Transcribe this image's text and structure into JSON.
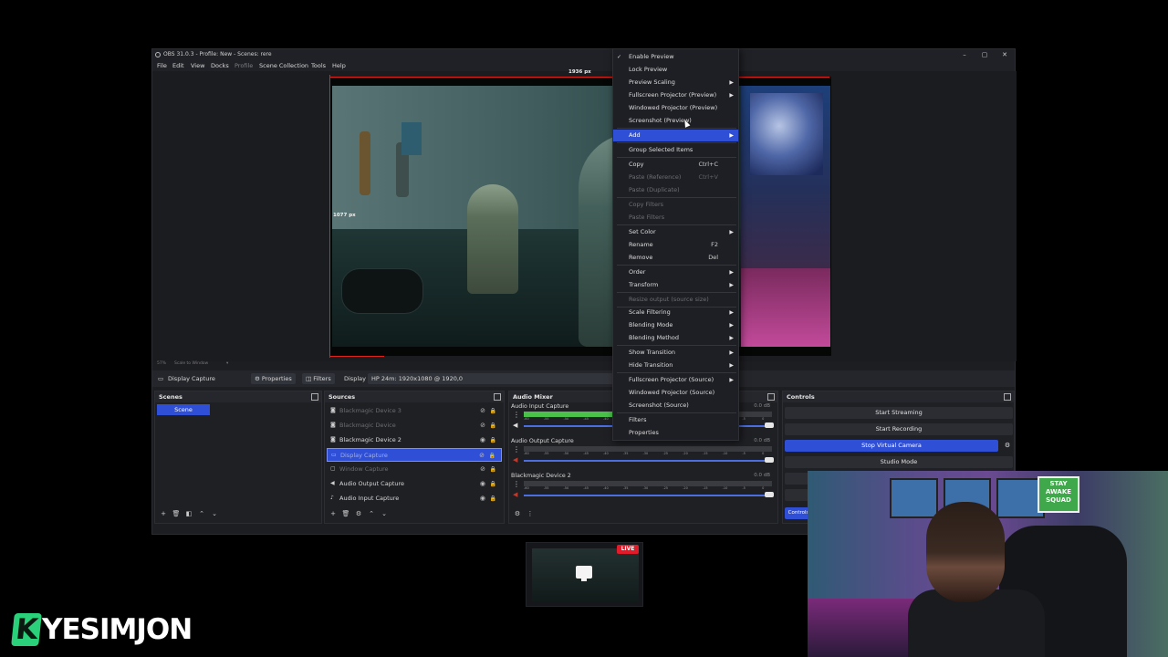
{
  "window": {
    "title": "OBS 31.0.3 - Profile: New - Scenes: rere",
    "minimize": "–",
    "maximize": "▢",
    "close": "✕"
  },
  "menubar": [
    "File",
    "Edit",
    "View",
    "Docks",
    "Profile",
    "Scene Collection",
    "Tools",
    "Help"
  ],
  "preview": {
    "width_label": "1936 px",
    "height_label": "1077 px",
    "zoom": "57%",
    "scale_mode": "Scale to Window"
  },
  "source_bar": {
    "source_name": "Display Capture",
    "properties": "Properties",
    "filters": "Filters",
    "display_label": "Display",
    "display_value": "HP 24m: 1920x1080 @ 1920,0"
  },
  "scenes": {
    "title": "Scenes",
    "items": [
      "Scene"
    ]
  },
  "sources": {
    "title": "Sources",
    "items": [
      {
        "name": "Blackmagic Device 3",
        "icon": "camera-icon",
        "visible": false
      },
      {
        "name": "Blackmagic Device",
        "icon": "camera-icon",
        "visible": false
      },
      {
        "name": "Blackmagic Device 2",
        "icon": "camera-icon",
        "visible": true
      },
      {
        "name": "Display Capture",
        "icon": "monitor-icon",
        "visible": false,
        "selected": true
      },
      {
        "name": "Window Capture",
        "icon": "window-icon",
        "visible": false
      },
      {
        "name": "Audio Output Capture",
        "icon": "speaker-icon",
        "visible": true
      },
      {
        "name": "Audio Input Capture",
        "icon": "mic-icon",
        "visible": true
      }
    ]
  },
  "mixer": {
    "title": "Audio Mixer",
    "channels": [
      {
        "name": "Audio Input Capture",
        "db": "0.0 dB",
        "level": 0.62
      },
      {
        "name": "Audio Output Capture",
        "db": "0.0 dB",
        "level": 0.0
      },
      {
        "name": "Blackmagic Device 2",
        "db": "0.0 dB",
        "level": 0.0
      }
    ],
    "ticks": [
      "-60",
      "-55",
      "-50",
      "-45",
      "-40",
      "-35",
      "-30",
      "-25",
      "-20",
      "-15",
      "-10",
      "-5",
      "0"
    ]
  },
  "controls": {
    "title": "Controls",
    "start_streaming": "Start Streaming",
    "start_recording": "Start Recording",
    "stop_virtual_camera": "Stop Virtual Camera",
    "studio_mode": "Studio Mode",
    "tab": "Controls"
  },
  "context_menu": {
    "enable_preview": "Enable Preview",
    "lock_preview": "Lock Preview",
    "preview_scaling": "Preview Scaling",
    "fullscreen_projector_preview": "Fullscreen Projector (Preview)",
    "windowed_projector_preview": "Windowed Projector (Preview)",
    "screenshot_preview": "Screenshot (Preview)",
    "add": "Add",
    "group_selected": "Group Selected Items",
    "copy": "Copy",
    "copy_shortcut": "Ctrl+C",
    "paste_reference": "Paste (Reference)",
    "paste_reference_shortcut": "Ctrl+V",
    "paste_duplicate": "Paste (Duplicate)",
    "copy_filters": "Copy Filters",
    "paste_filters": "Paste Filters",
    "set_color": "Set Color",
    "rename": "Rename",
    "rename_shortcut": "F2",
    "remove": "Remove",
    "remove_shortcut": "Del",
    "order": "Order",
    "transform": "Transform",
    "resize_output": "Resize output (source size)",
    "scale_filtering": "Scale Filtering",
    "blending_mode": "Blending Mode",
    "blending_method": "Blending Method",
    "show_transition": "Show Transition",
    "hide_transition": "Hide Transition",
    "fullscreen_projector_source": "Fullscreen Projector (Source)",
    "windowed_projector_source": "Windowed Projector (Source)",
    "screenshot_source": "Screenshot (Source)",
    "filters": "Filters",
    "properties": "Properties"
  },
  "overlay": {
    "live_badge": "LIVE",
    "brand": "YESIMJON",
    "brand_initial": "K",
    "stay_awake": "STAY AWAKE SQUAD"
  }
}
